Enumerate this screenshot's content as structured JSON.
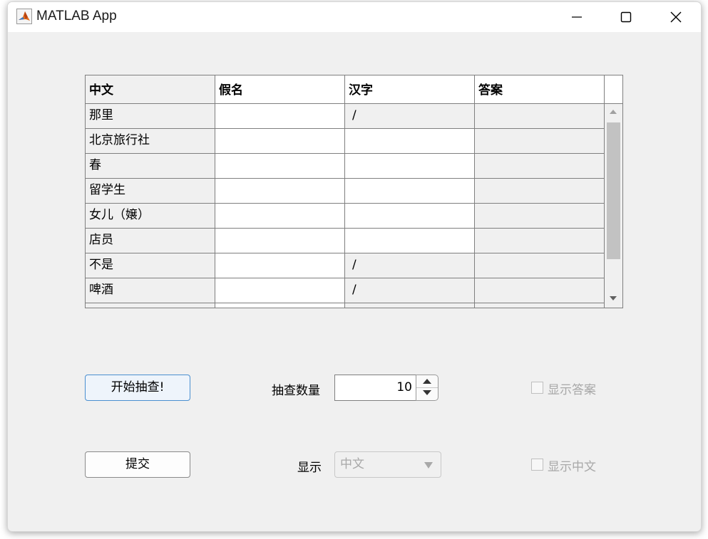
{
  "window": {
    "title": "MATLAB App"
  },
  "table": {
    "columns": [
      "中文",
      "假名",
      "汉字",
      "答案"
    ],
    "rows": [
      {
        "chinese": "那里",
        "kana": "",
        "kanji": "/",
        "answer": "",
        "kanji_readonly": true
      },
      {
        "chinese": "北京旅行社",
        "kana": "",
        "kanji": "",
        "answer": "",
        "kanji_readonly": false
      },
      {
        "chinese": "春",
        "kana": "",
        "kanji": "",
        "answer": "",
        "kanji_readonly": false
      },
      {
        "chinese": "留学生",
        "kana": "",
        "kanji": "",
        "answer": "",
        "kanji_readonly": false
      },
      {
        "chinese": "女儿（嬢）",
        "kana": "",
        "kanji": "",
        "answer": "",
        "kanji_readonly": false
      },
      {
        "chinese": "店员",
        "kana": "",
        "kanji": "",
        "answer": "",
        "kanji_readonly": false
      },
      {
        "chinese": "不是",
        "kana": "",
        "kanji": "/",
        "answer": "",
        "kanji_readonly": true
      },
      {
        "chinese": "啤酒",
        "kana": "",
        "kanji": "/",
        "answer": "",
        "kanji_readonly": true
      }
    ]
  },
  "controls": {
    "start_button": "开始抽查!",
    "submit_button": "提交",
    "count_label": "抽查数量",
    "count_value": "10",
    "show_label": "显示",
    "show_dropdown_value": "中文",
    "show_answer_checkbox": "显示答案",
    "show_answer_checked": false,
    "show_chinese_checkbox": "显示中文",
    "show_chinese_checked": false
  }
}
